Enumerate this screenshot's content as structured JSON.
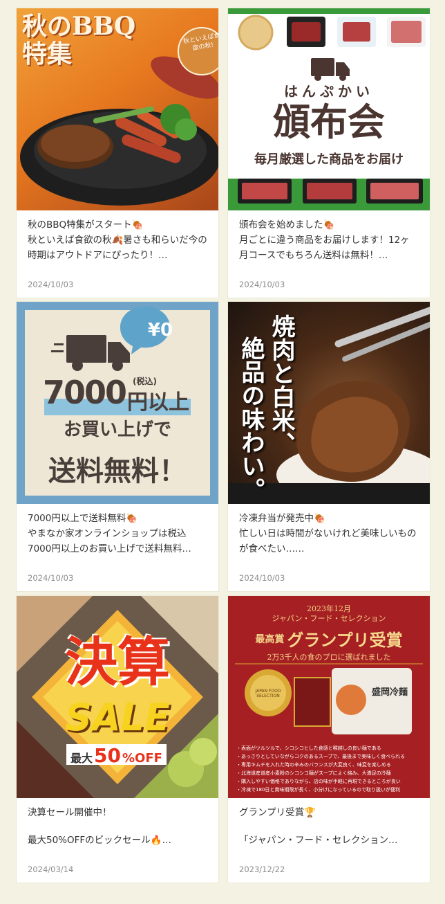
{
  "cards": [
    {
      "image": {
        "title": "秋のBBQ特集",
        "badge": "秋といえば食欲の秋!"
      },
      "title": "秋のBBQ特集がスタート🍖",
      "desc": "秋といえば食欲の秋🍂暑さも和らいだ今の時期はアウトドアにぴったり！…",
      "date": "2024/10/03"
    },
    {
      "image": {
        "ruby": "はんぷかい",
        "heading": "頒布会",
        "sub": "毎月厳選した商品をお届け"
      },
      "title": "頒布会を始めました🍖",
      "desc": "月ごとに違う商品をお届けします！12ヶ月コースでもちろん送料は無料！…",
      "date": "2024/10/03"
    },
    {
      "image": {
        "bubble": "¥0",
        "amount": "7000",
        "tax": "(税込)",
        "unit": "円以上",
        "line2": "お買い上げで",
        "line3": "送料無料！"
      },
      "title": "7000円以上で送料無料🍖",
      "desc": "やまなか家オンラインショップは税込7000円以上のお買い上げで送料無料…",
      "date": "2024/10/03"
    },
    {
      "image": {
        "col1": "焼肉と白米、",
        "col2": "絶品の味わい。"
      },
      "title": "冷凍弁当が発売中🍖",
      "desc": "忙しい日は時間がないけれど美味しいものが食べたい……",
      "date": "2024/10/03"
    },
    {
      "image": {
        "big": "決算",
        "sale": "SALE",
        "prefix": "最大",
        "percent": "50",
        "suffix": "%OFF"
      },
      "title": "決算セール開催中！",
      "desc": "最大50%OFFのビックセール🔥…",
      "date": "2024/03/14"
    },
    {
      "image": {
        "top": "2023年12月",
        "top2": "ジャパン・フード・セレクション",
        "award_small": "最高賞",
        "award": "グランプリ受賞",
        "sub": "2万3千人の食のプロに選ばれました",
        "medal": "JAPAN FOOD SELECTION",
        "product": "盛岡冷麺",
        "bullets": [
          "・表面がツルツルで、シコシコとした食感と喉越しの良い麺である",
          "・あっさりとしていながらコクのあるスープで、最後まで美味しく食べられる",
          "・専用キムチを入れた時の辛みのバランスが大変良く、味変を楽しめる",
          "・北海道産道産小麦粉のシコシコ麺がスープによく絡み、大満足の冷麺",
          "・購入しやすい価格でありながら、店の味が手軽に再現できるところが良い",
          "・冷凍で180日と賞味期限が長く、小分けになっているので取り扱いが便利"
        ]
      },
      "title": "グランプリ受賞🏆",
      "desc": "「ジャパン・フード・セレクション…",
      "date": "2023/12/22"
    }
  ]
}
